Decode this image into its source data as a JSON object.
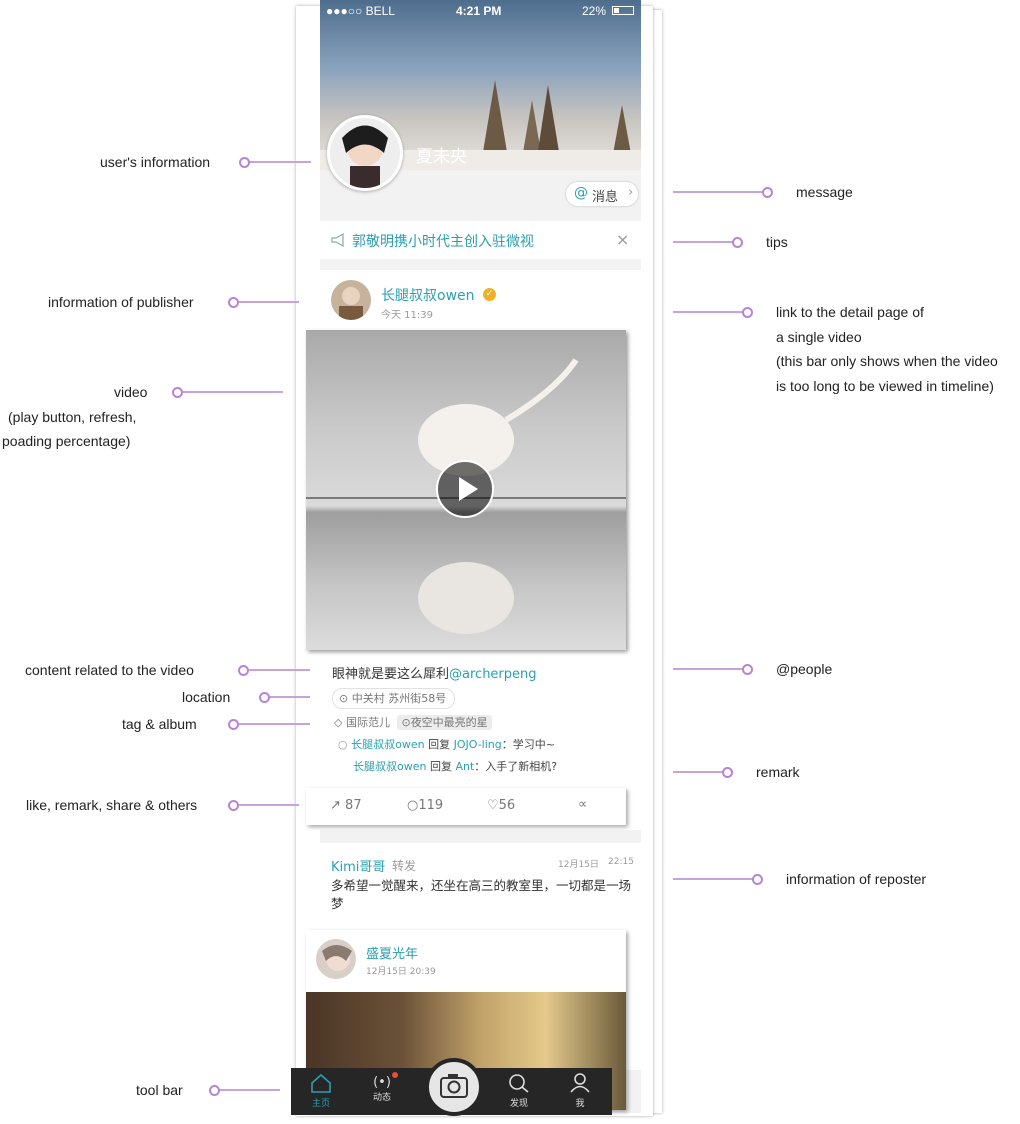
{
  "status_bar": {
    "carrier": "●●●○○ BELL",
    "time": "4:21 PM",
    "battery": "22%"
  },
  "profile": {
    "name": "夏未央",
    "message_label": "消息"
  },
  "tips": {
    "text": "郭敬明携小时代主创入驻微视"
  },
  "post": {
    "author": "长腿叔叔owen",
    "time": "今天 11:39",
    "caption": "眼神就是要这么犀利",
    "mention": "@archerpeng",
    "location": "中关村 苏州街58号",
    "tag": "国际范儿",
    "album": "夜空中最亮的星",
    "comments": [
      {
        "user": "长腿叔叔owen",
        "action": "回复",
        "target": "JOJO-ling",
        "text": "：学习中~"
      },
      {
        "user": "长腿叔叔owen",
        "action": "回复",
        "target": "Ant",
        "text": "：入手了新相机?"
      }
    ],
    "actions": {
      "share_count": "87",
      "comment_count": "119",
      "like_count": "56"
    }
  },
  "repost": {
    "reposter": "Kimi哥哥",
    "repost_label": "转发",
    "date": "12月15日",
    "time": "22:15",
    "text": "多希望一觉醒来，还坐在高三的教室里，一切都是一场梦",
    "original_author": "盛夏光年",
    "original_time": "12月15日  20:39"
  },
  "tab_bar": {
    "home": "主页",
    "activity": "动态",
    "discover": "发现",
    "me": "我"
  },
  "annotations": {
    "users_information": "user's information",
    "message": "message",
    "tips": "tips",
    "publisher": "information of publisher",
    "detail_link_1": "link to the detail page of",
    "detail_link_2": "a single video",
    "detail_link_3": "(this bar only shows when the video",
    "detail_link_4": "is too long to be viewed in timeline)",
    "video_1": "video",
    "video_2": "(play button, refresh,",
    "video_3": "poading percentage)",
    "content": "content related to the video",
    "people": "@people",
    "location": "location",
    "tag_album": "tag & album",
    "remark": "remark",
    "actions": "like, remark, share & others",
    "reposter": "information of reposter",
    "toolbar": "tool bar"
  },
  "colors": {
    "accent": "#2a9fb0",
    "annotation": "#b884d4",
    "tabbar": "#262626"
  }
}
